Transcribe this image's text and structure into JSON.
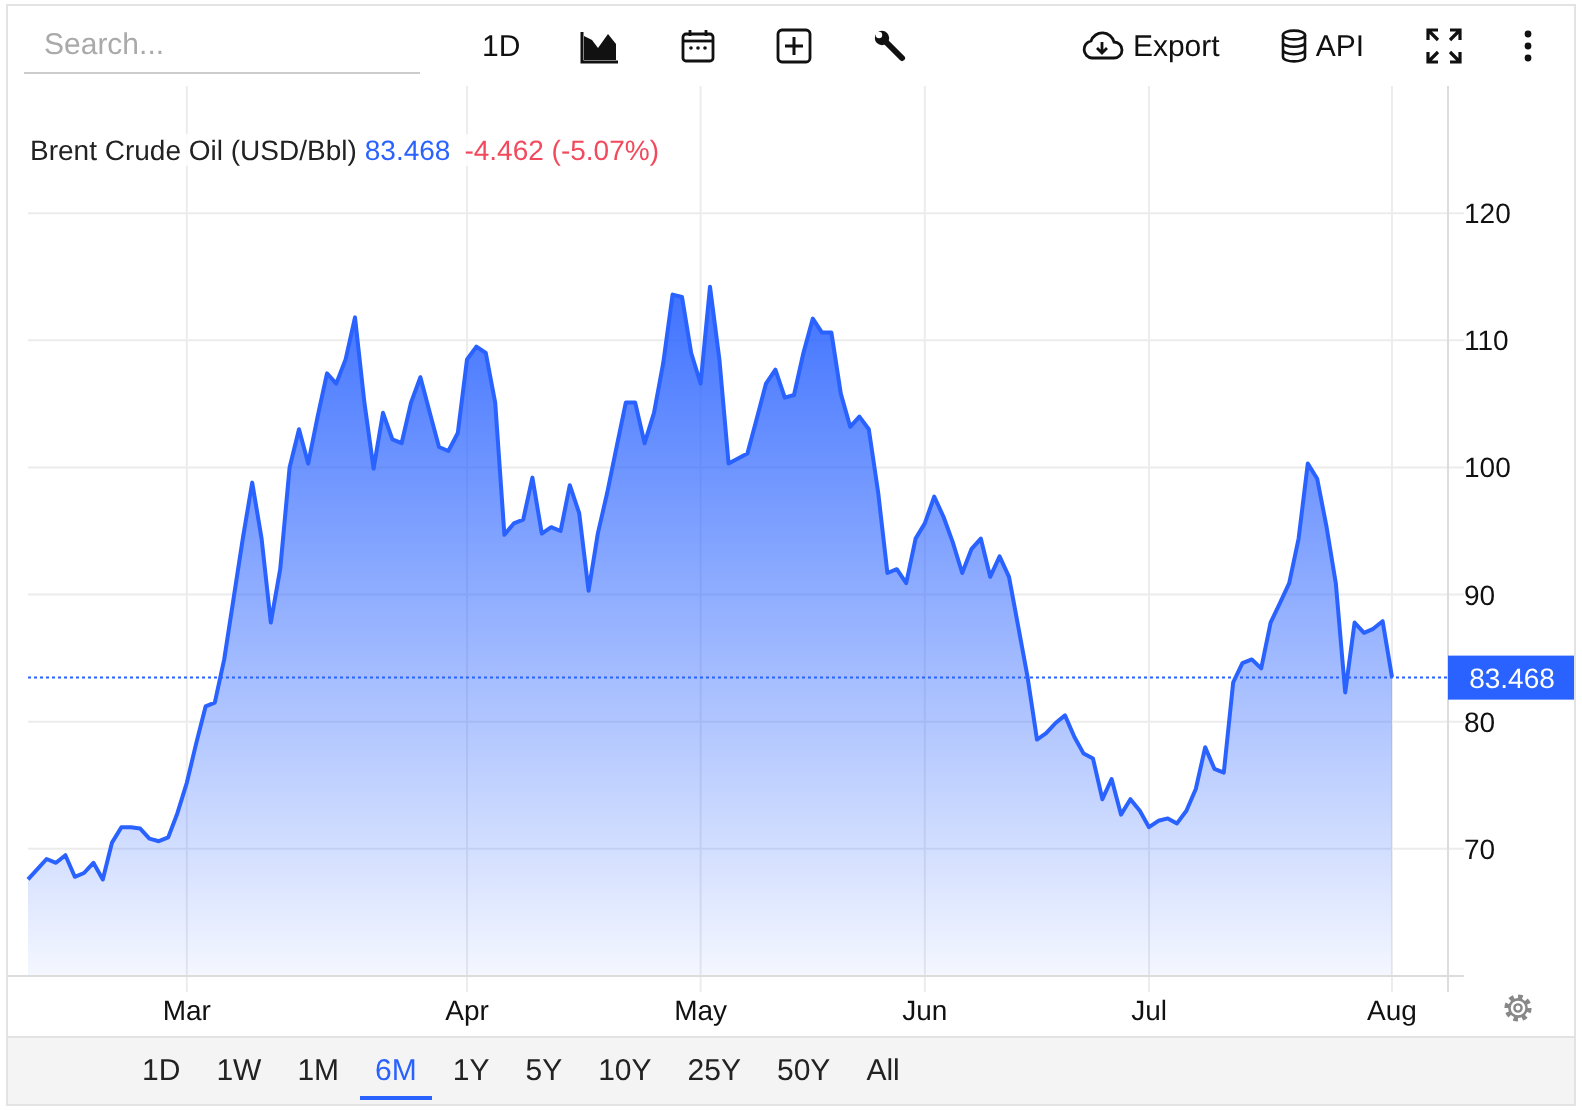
{
  "toolbar": {
    "search": {
      "placeholder": "Search..."
    },
    "interval": "1D",
    "export_label": "Export",
    "api_label": "API"
  },
  "chart": {
    "price": "83.468",
    "change": "-4.462 (-5.07%)",
    "last_price_label": "83.468",
    "chart_data": {
      "type": "area",
      "categories": [
        null,
        null,
        null,
        null,
        null,
        null,
        null,
        null,
        null,
        null,
        null,
        null,
        null,
        null,
        null,
        null,
        null,
        "Mar",
        null,
        null,
        null,
        null,
        null,
        null,
        null,
        null,
        null,
        null,
        null,
        null,
        null,
        null,
        null,
        null,
        null,
        null,
        null,
        null,
        null,
        null,
        null,
        null,
        null,
        null,
        null,
        null,
        null,
        "Apr",
        null,
        null,
        null,
        null,
        null,
        null,
        null,
        null,
        null,
        null,
        null,
        null,
        null,
        null,
        null,
        null,
        null,
        null,
        null,
        null,
        null,
        null,
        null,
        null,
        "May",
        null,
        null,
        null,
        null,
        null,
        null,
        null,
        null,
        null,
        null,
        null,
        null,
        null,
        null,
        null,
        null,
        null,
        null,
        null,
        null,
        null,
        null,
        null,
        "Jun",
        null,
        null,
        null,
        null,
        null,
        null,
        null,
        null,
        null,
        null,
        null,
        null,
        null,
        null,
        null,
        null,
        null,
        null,
        null,
        null,
        null,
        null,
        null,
        "Jul",
        null,
        null,
        null,
        null,
        null,
        null,
        null,
        null,
        null,
        null,
        null,
        null,
        null,
        null,
        null,
        null,
        null,
        null,
        null,
        null,
        null,
        null,
        null,
        null,
        null,
        "Aug"
      ],
      "series": [
        {
          "name": "Brent Crude Oil (USD/Bbl)",
          "color": "#2962ff",
          "values": [
            67.6,
            68.4,
            69.2,
            68.9,
            69.5,
            67.8,
            68.1,
            68.9,
            67.6,
            70.5,
            71.7,
            71.7,
            71.6,
            70.8,
            70.6,
            70.9,
            72.8,
            75.2,
            78.3,
            81.2,
            81.5,
            84.9,
            89.7,
            94.4,
            98.8,
            94.4,
            87.8,
            92.0,
            100.0,
            103.0,
            100.3,
            104.0,
            107.4,
            106.6,
            108.5,
            111.8,
            105.1,
            99.9,
            104.3,
            102.2,
            101.9,
            105.1,
            107.1,
            104.3,
            101.6,
            101.3,
            102.7,
            108.5,
            109.5,
            109.0,
            105.1,
            94.7,
            95.6,
            95.9,
            99.2,
            94.8,
            95.3,
            95.0,
            98.6,
            96.4,
            90.3,
            94.8,
            98.0,
            101.6,
            105.1,
            105.1,
            101.9,
            104.3,
            108.2,
            113.6,
            113.4,
            109.0,
            106.6,
            114.2,
            108.5,
            100.3,
            100.7,
            101.1,
            103.8,
            106.6,
            107.7,
            105.5,
            105.7,
            109.0,
            111.7,
            110.6,
            110.6,
            105.8,
            103.2,
            104.0,
            103.0,
            98.0,
            91.7,
            92.0,
            90.9,
            94.4,
            95.6,
            97.7,
            96.1,
            94.1,
            91.7,
            93.6,
            94.4,
            91.4,
            93.0,
            91.4,
            87.5,
            83.5,
            78.6,
            79.1,
            79.9,
            80.5,
            78.8,
            77.5,
            77.1,
            73.9,
            75.5,
            72.7,
            73.9,
            73.0,
            71.7,
            72.2,
            72.4,
            72.0,
            73.0,
            74.7,
            78.0,
            76.3,
            76.0,
            83.1,
            84.6,
            84.9,
            84.2,
            87.8,
            89.3,
            90.9,
            94.4,
            100.3,
            99.1,
            95.3,
            90.9,
            82.3,
            87.8,
            87.0,
            87.3,
            87.9,
            83.5
          ]
        }
      ],
      "grid": true,
      "ref_lines": [
        {
          "axis": "y",
          "value": 83.468
        }
      ],
      "ylim": [
        60,
        130
      ],
      "yticks": [
        70,
        80,
        90,
        100,
        110,
        120
      ]
    }
  },
  "ranges": [
    {
      "label": "1D",
      "selected": false
    },
    {
      "label": "1W",
      "selected": false
    },
    {
      "label": "1M",
      "selected": false
    },
    {
      "label": "6M",
      "selected": true
    },
    {
      "label": "1Y",
      "selected": false
    },
    {
      "label": "5Y",
      "selected": false
    },
    {
      "label": "10Y",
      "selected": false
    },
    {
      "label": "25Y",
      "selected": false
    },
    {
      "label": "50Y",
      "selected": false
    },
    {
      "label": "All",
      "selected": false
    }
  ]
}
